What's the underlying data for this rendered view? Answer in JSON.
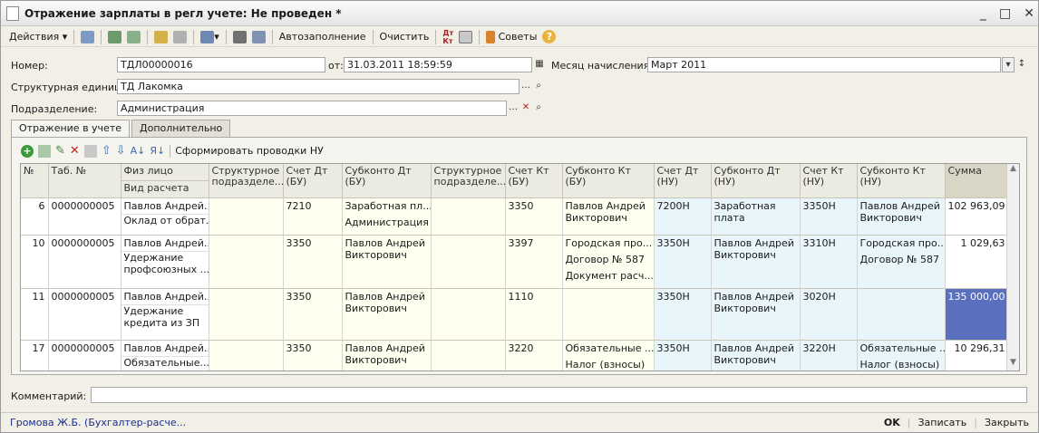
{
  "window": {
    "title": "Отражение зарплаты в регл учете: Не проведен *",
    "controls": [
      "_",
      "□",
      "✕"
    ]
  },
  "toolbar": {
    "actions": "Действия",
    "autofill": "Автозаполнение",
    "clear": "Очистить",
    "tips": "Советы"
  },
  "form": {
    "number_label": "Номер:",
    "number": "ТДЛ00000016",
    "date_label": "от:",
    "date": "31.03.2011 18:59:59",
    "month_label": "Месяц начисления:",
    "month": "Март 2011",
    "unit_label": "Структурная единица:",
    "unit": "ТД Лакомка",
    "dept_label": "Подразделение:",
    "dept": "Администрация"
  },
  "tabs": [
    "Отражение в учете",
    "Дополнительно"
  ],
  "inner_toolbar": {
    "generate": "Сформировать проводки НУ"
  },
  "table": {
    "headers": [
      "№",
      "Таб. №",
      "Физ лицо",
      "Структурное подразделе...",
      "Счет Дт (БУ)",
      "Субконто Дт (БУ)",
      "Структурное подразделе...",
      "Счет Кт (БУ)",
      "Субконто Кт (БУ)",
      "Счет Дт (НУ)",
      "Субконто Дт (НУ)",
      "Счет Кт (НУ)",
      "Субконто Кт (НУ)",
      "Сумма"
    ],
    "subheader": "Вид расчета",
    "rows": [
      {
        "n": "6",
        "tab": "0000000005",
        "person": "Павлов Андрей...",
        "kind": [
          "Оклад от обрат..."
        ],
        "dt_bu": "7210",
        "sub_dt_bu": [
          "Заработная пл...",
          "Администрация"
        ],
        "kt_bu": "3350",
        "sub_kt_bu": [
          "Павлов Андрей",
          "Викторович"
        ],
        "dt_nu": "7200Н",
        "sub_dt_nu": [
          "Заработная",
          "плата"
        ],
        "kt_nu": "3350Н",
        "sub_kt_nu": [
          "Павлов Андрей",
          "Викторович"
        ],
        "sum": "102 963,09"
      },
      {
        "n": "10",
        "tab": "0000000005",
        "person": "Павлов Андрей...",
        "kind": [
          "Удержание",
          "профсоюзных ..."
        ],
        "dt_bu": "3350",
        "sub_dt_bu": [
          "Павлов Андрей",
          "Викторович"
        ],
        "kt_bu": "3397",
        "sub_kt_bu": [
          "Городская про...",
          "Договор № 587",
          "Документ расч..."
        ],
        "dt_nu": "3350Н",
        "sub_dt_nu": [
          "Павлов Андрей",
          "Викторович"
        ],
        "kt_nu": "3310Н",
        "sub_kt_nu": [
          "Городская про...",
          "Договор № 587"
        ],
        "sum": "1 029,63"
      },
      {
        "n": "11",
        "tab": "0000000005",
        "person": "Павлов Андрей...",
        "kind": [
          "Удержание",
          "кредита из ЗП"
        ],
        "dt_bu": "3350",
        "sub_dt_bu": [
          "Павлов Андрей",
          "Викторович"
        ],
        "kt_bu": "1110",
        "sub_kt_bu": [],
        "dt_nu": "3350Н",
        "sub_dt_nu": [
          "Павлов Андрей",
          "Викторович"
        ],
        "kt_nu": "3020Н",
        "sub_kt_nu": [],
        "sum": "135 000,00"
      },
      {
        "n": "17",
        "tab": "0000000005",
        "person": "Павлов Андрей...",
        "kind": [
          "Обязательные..."
        ],
        "dt_bu": "3350",
        "sub_dt_bu": [
          "Павлов Андрей",
          "Викторович"
        ],
        "kt_bu": "3220",
        "sub_kt_bu": [
          "Обязательные ...",
          "Налог (взносы)"
        ],
        "dt_nu": "3350Н",
        "sub_dt_nu": [
          "Павлов Андрей",
          "Викторович"
        ],
        "kt_nu": "3220Н",
        "sub_kt_nu": [
          "Обязательные ...",
          "Налог (взносы)"
        ],
        "sum": "10 296,31"
      }
    ]
  },
  "comment_label": "Комментарий:",
  "status": {
    "user": "Громова Ж.Б. (Бухгалтер-расче...",
    "ok": "OK",
    "save": "Записать",
    "close": "Закрыть"
  },
  "colors": {
    "selected": "#5b6fbf",
    "bu_cell": "#fffff0",
    "nu_cell": "#e8f6fc"
  }
}
